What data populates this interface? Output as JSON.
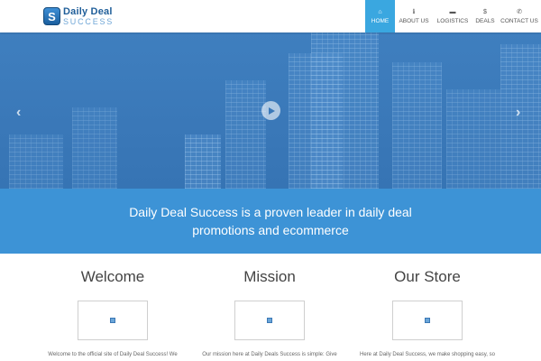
{
  "logo": {
    "mark": "S",
    "line1": "Daily Deal",
    "line2": "SUCCESS"
  },
  "nav": {
    "items": [
      {
        "icon": "⌂",
        "label": "HOME"
      },
      {
        "icon": "ℹ",
        "label": "ABOUT US"
      },
      {
        "icon": "▬",
        "label": "LOGISTICS"
      },
      {
        "icon": "$",
        "label": "DEALS"
      },
      {
        "icon": "✆",
        "label": "CONTACT US"
      }
    ],
    "active_index": 0
  },
  "hero": {
    "prev_icon": "‹",
    "next_icon": "›"
  },
  "tagline": {
    "text": "Daily Deal Success is a proven leader in daily deal promotions and ecommerce"
  },
  "columns": [
    {
      "title": "Welcome",
      "text": "Welcome to the official site of Daily Deal Success! We"
    },
    {
      "title": "Mission",
      "text": "Our mission here at Daily Deals Success is simple: Give"
    },
    {
      "title": "Our Store",
      "text": "Here at Daily Deal Success, we make shopping easy, so"
    }
  ],
  "colors": {
    "accent": "#3aa7e0",
    "tagline_bg": "#3d93d6",
    "hero_bg": "#3a78b8"
  }
}
